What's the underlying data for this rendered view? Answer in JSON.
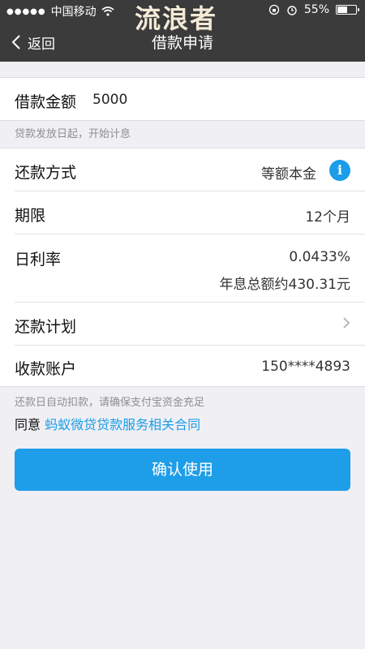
{
  "status_bar": {
    "carrier": "中国移动",
    "battery": "55%",
    "battery_level": 0.55
  },
  "watermark": "流浪者",
  "nav": {
    "back_label": "返回",
    "title": "借款申请"
  },
  "loan": {
    "amount_label": "借款金额",
    "amount_value": "5000",
    "hint": "贷款发放日起，开始计息"
  },
  "details": {
    "repay_method_label": "还款方式",
    "repay_method_value": "等额本金",
    "term_label": "期限",
    "term_value": "12个月",
    "daily_rate_label": "日利率",
    "daily_rate_value": "0.0433%",
    "total_interest_value": "年息总额约430.31元",
    "repay_plan_label": "还款计划",
    "account_label": "收款账户",
    "account_value": "150****4893"
  },
  "footer": {
    "auto_debit_hint": "还款日自动扣款，请确保支付宝资金充足",
    "agree_prefix": "同意",
    "contract_link": "蚂蚁微贷贷款服务相关合同",
    "confirm_button": "确认使用"
  },
  "colors": {
    "accent": "#1e9de9",
    "nav_bg": "#3b3b3b",
    "page_bg": "#efeff4"
  }
}
